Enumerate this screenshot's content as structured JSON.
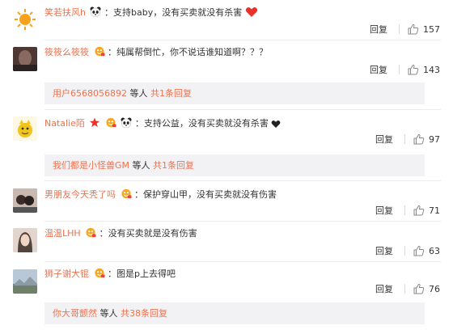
{
  "colors": {
    "link": "#eb7350",
    "text": "#333333",
    "subbox_bg": "#f2f2f5"
  },
  "comments": [
    {
      "user": "笑若扶风h",
      "badges": [
        "panda-emoji"
      ],
      "text": "：支持baby，没有买卖就没有杀害",
      "trailing_icon": "red-heart-icon",
      "reply_label": "回复",
      "likes": "157"
    },
    {
      "user": "筱筱么筱筱",
      "badges": [
        "vip-badge-icon"
      ],
      "text": "：纯属帮倒忙，你不说话谁知道啊？？？",
      "reply_label": "回复",
      "likes": "143",
      "sub": {
        "lead": "用户6568056892",
        "mid": " 等人 ",
        "link": "共1条回复"
      }
    },
    {
      "user": "Natalie陌",
      "badges": [
        "red-star-icon",
        "vip-badge-icon",
        "panda-emoji"
      ],
      "text": "：支持公益，没有买卖就没有杀害",
      "trailing_icon": "black-heart-icon",
      "reply_label": "回复",
      "likes": "97",
      "sub": {
        "lead": "我们都是小怪兽GM",
        "mid": " 等人 ",
        "link": "共1条回复"
      }
    },
    {
      "user": "男朋友今天秃了吗",
      "badges": [
        "vip-badge-icon"
      ],
      "text": "：保护穿山甲，没有买卖就没有伤害",
      "reply_label": "回复",
      "likes": "71"
    },
    {
      "user": "温温LHH",
      "badges": [
        "vip-badge-icon"
      ],
      "text": "：没有买卖就是没有伤害",
      "reply_label": "回复",
      "likes": "63"
    },
    {
      "user": "狮子谢大锟",
      "badges": [
        "vip-badge-icon"
      ],
      "text": "：图是p上去得吧",
      "reply_label": "回复",
      "likes": "76",
      "sub": {
        "lead": "你大哥颤然",
        "mid": " 等人 ",
        "link": "共38条回复"
      }
    }
  ]
}
